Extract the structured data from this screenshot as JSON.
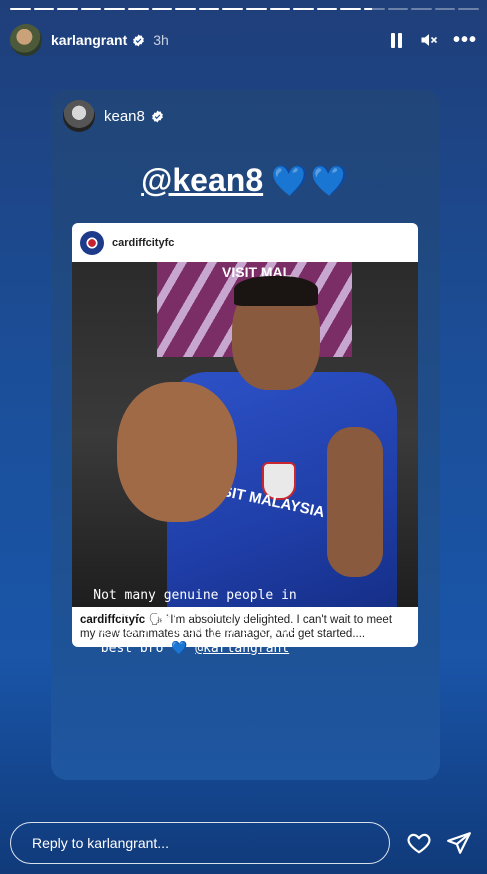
{
  "progress": {
    "segments": 20,
    "completed": 15,
    "current_fraction": 0.4
  },
  "header": {
    "username": "karlangrant",
    "verified": true,
    "time": "3h",
    "icons": [
      "pause-icon",
      "mute-icon",
      "more-icon"
    ]
  },
  "card": {
    "username": "kean8",
    "verified": true,
    "mention": "@kean8",
    "hearts": "💙💙",
    "post": {
      "username": "cardiffcityfc",
      "jersey_text": "VISIT MAL",
      "sponsor_text": "VISIT MALAYSIA",
      "caption_user": "cardiffcityfc",
      "caption_text": "\"I'm absolutely delighted. I can't wait to meet my new teammates and the manager, and get started...."
    }
  },
  "story_text": {
    "line1": "Not many genuine people in",
    "line2": "ball but this guy is",
    "line3": "serious . Wish you all the",
    "line4_pre": "best bro",
    "line4_heart": "💙",
    "line4_link": "@karlangrant"
  },
  "footer": {
    "reply_placeholder": "Reply to karlangrant...",
    "icons": [
      "heart-icon",
      "send-icon"
    ]
  },
  "colors": {
    "accent_blue": "#1f4f9a",
    "heart_blue": "#2b8cf0"
  }
}
